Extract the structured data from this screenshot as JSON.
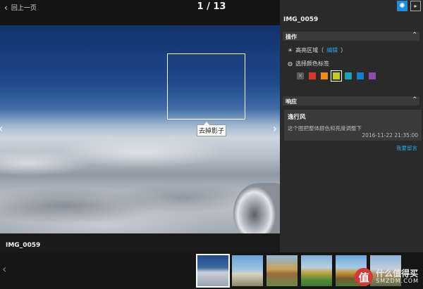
{
  "header": {
    "back_label": "回上一页",
    "counter": "1 / 13"
  },
  "viewer": {
    "tag_label": "去掉影子",
    "caption": "IMG_0059"
  },
  "panel": {
    "title": "IMG_0059",
    "operations_header": "操作",
    "highlight_label": "高亮区域（",
    "highlight_edit": "编辑",
    "highlight_close": "）",
    "color_tag_label": "选择颜色标签",
    "swatch_colors": [
      "#5a5a5a",
      "#d8372c",
      "#ef8c14",
      "#c0cc23",
      "#1aa3b5",
      "#1680d0",
      "#8f4ab5"
    ],
    "selected_swatch_index": 3,
    "response_header": "响应",
    "comment": {
      "author": "逸行风",
      "text": "这个图把整体颜色和亮度调整下",
      "time": "2016-11-22 21:35:00"
    },
    "reply_label": "我要留言",
    "accent_color": "#1d8fd6"
  },
  "filmstrip": {
    "selected_index": 0,
    "thumbnail_count": 6
  },
  "watermark": {
    "logo": "值",
    "cn": "什么值得买",
    "en": "SMZDM.COM"
  }
}
